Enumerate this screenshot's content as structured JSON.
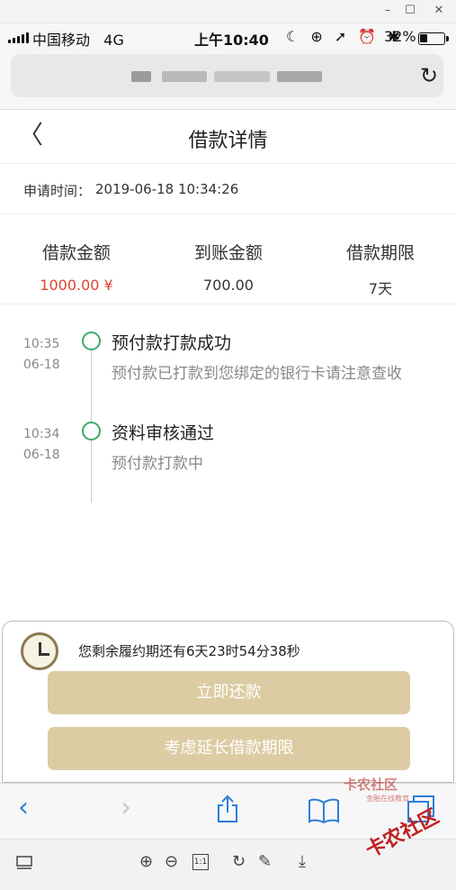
{
  "window": {
    "minimize": "–",
    "maximize": "☐",
    "close": "✕"
  },
  "status_bar": {
    "carrier": "中国移动",
    "network": "4G",
    "time": "上午10:40",
    "icons": "☾ ⊕ ➚ ⏰ ✱",
    "battery_percent": "32%",
    "battery_level": 0.32
  },
  "url_bar": {
    "reload_icon": "↻"
  },
  "header": {
    "back_icon": "〈",
    "title": "借款详情"
  },
  "apply": {
    "label": "申请时间：",
    "value": "2019-06-18 10:34:26"
  },
  "amounts": [
    {
      "label": "借款金额",
      "value": "1000.00 ¥"
    },
    {
      "label": "到账金额",
      "value": "700.00"
    },
    {
      "label": "借款期限",
      "value": "7天"
    }
  ],
  "timeline": [
    {
      "time": "10:35",
      "date": "06-18",
      "title": "预付款打款成功",
      "desc": "预付款已打款到您绑定的银行卡请注意查收"
    },
    {
      "time": "10:34",
      "date": "06-18",
      "title": "资料审核通过",
      "desc": "预付款打款中"
    }
  ],
  "panel": {
    "countdown": "您剩余履约期还有6天23时54分38秒",
    "repay_button": "立即还款",
    "extend_button": "考虑延长借款期限"
  },
  "browser_toolbar": {
    "back_icon": "‹",
    "forward_icon": "›"
  },
  "pdf_toolbar": {
    "page_label": "1:1"
  },
  "watermark": {
    "top": "卡农社区",
    "sub": "金融在线教育",
    "big": "卡农社区"
  },
  "colors": {
    "accent_green": "#3aaa6a",
    "amount_red": "#e0442e",
    "button_gold": "#dccca4",
    "ios_blue": "#2d7fd8"
  }
}
